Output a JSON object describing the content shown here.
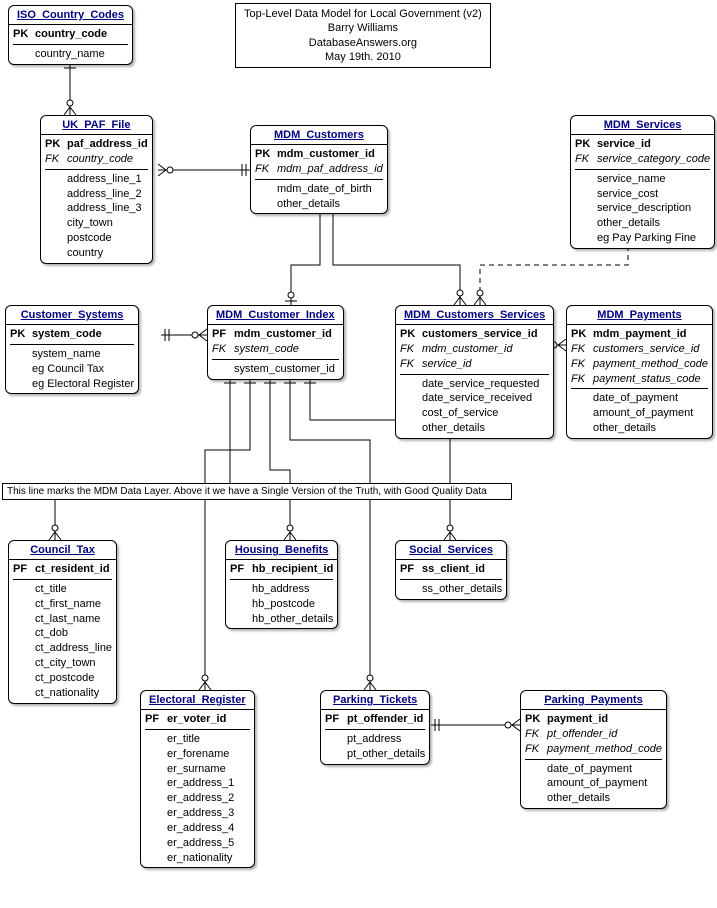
{
  "title": {
    "l1": "Top-Level Data Model for Local Government (v2)",
    "l2": "Barry Williams",
    "l3": "DatabaseAnswers.org",
    "l4": "May 19th. 2010"
  },
  "note": "This line marks the MDM Data Layer. Above it we have a Single Version of the Truth, with Good Quality Data",
  "e": {
    "iso": {
      "t": "ISO_Country_Codes",
      "a": [
        {
          "k": "PK",
          "n": "country_code",
          "pk": 1
        },
        {
          "k": "",
          "n": "country_name"
        }
      ]
    },
    "paf": {
      "t": "UK_PAF_File",
      "a": [
        {
          "k": "PK",
          "n": "paf_address_id",
          "pk": 1
        },
        {
          "k": "FK",
          "n": "country_code",
          "fk": 1
        },
        {
          "k": "",
          "n": "address_line_1"
        },
        {
          "k": "",
          "n": "address_line_2"
        },
        {
          "k": "",
          "n": "address_line_3"
        },
        {
          "k": "",
          "n": "city_town"
        },
        {
          "k": "",
          "n": "postcode"
        },
        {
          "k": "",
          "n": "country"
        }
      ]
    },
    "cust": {
      "t": "MDM_Customers",
      "a": [
        {
          "k": "PK",
          "n": "mdm_customer_id",
          "pk": 1
        },
        {
          "k": "FK",
          "n": "mdm_paf_address_id",
          "fk": 1
        },
        {
          "k": "",
          "n": "mdm_date_of_birth"
        },
        {
          "k": "",
          "n": "other_details"
        }
      ]
    },
    "svc": {
      "t": "MDM_Services",
      "a": [
        {
          "k": "PK",
          "n": "service_id",
          "pk": 1
        },
        {
          "k": "FK",
          "n": "service_category_code",
          "fk": 1
        },
        {
          "k": "",
          "n": "service_name"
        },
        {
          "k": "",
          "n": "service_cost"
        },
        {
          "k": "",
          "n": "service_description"
        },
        {
          "k": "",
          "n": "other_details"
        },
        {
          "k": "",
          "n": "eg Pay Parking Fine"
        }
      ]
    },
    "sys": {
      "t": "Customer_Systems",
      "a": [
        {
          "k": "PK",
          "n": "system_code",
          "pk": 1
        },
        {
          "k": "",
          "n": "system_name"
        },
        {
          "k": "",
          "n": "eg Council Tax"
        },
        {
          "k": "",
          "n": "eg Electoral Register"
        }
      ]
    },
    "idx": {
      "t": "MDM_Customer_Index",
      "a": [
        {
          "k": "PF",
          "n": "mdm_customer_id",
          "pk": 1
        },
        {
          "k": "FK",
          "n": "system_code",
          "fk": 1
        },
        {
          "k": "",
          "n": "system_customer_id"
        }
      ]
    },
    "cs": {
      "t": "MDM_Customers_Services",
      "a": [
        {
          "k": "PK",
          "n": "customers_service_id",
          "pk": 1
        },
        {
          "k": "FK",
          "n": "mdm_customer_id",
          "fk": 1
        },
        {
          "k": "FK",
          "n": "service_id",
          "fk": 1
        },
        {
          "k": "",
          "n": "date_service_requested"
        },
        {
          "k": "",
          "n": "date_service_received"
        },
        {
          "k": "",
          "n": "cost_of_service"
        },
        {
          "k": "",
          "n": "other_details"
        }
      ]
    },
    "pay": {
      "t": "MDM_Payments",
      "a": [
        {
          "k": "PK",
          "n": "mdm_payment_id",
          "pk": 1
        },
        {
          "k": "FK",
          "n": "customers_service_id",
          "fk": 1
        },
        {
          "k": "FK",
          "n": "payment_method_code",
          "fk": 1
        },
        {
          "k": "FK",
          "n": "payment_status_code",
          "fk": 1
        },
        {
          "k": "",
          "n": "date_of_payment"
        },
        {
          "k": "",
          "n": "amount_of_payment"
        },
        {
          "k": "",
          "n": "other_details"
        }
      ]
    },
    "ct": {
      "t": "Council_Tax",
      "a": [
        {
          "k": "PF",
          "n": "ct_resident_id",
          "pk": 1
        },
        {
          "k": "",
          "n": "ct_title"
        },
        {
          "k": "",
          "n": "ct_first_name"
        },
        {
          "k": "",
          "n": "ct_last_name"
        },
        {
          "k": "",
          "n": "ct_dob"
        },
        {
          "k": "",
          "n": "ct_address_line"
        },
        {
          "k": "",
          "n": "ct_city_town"
        },
        {
          "k": "",
          "n": "ct_postcode"
        },
        {
          "k": "",
          "n": "ct_nationality"
        }
      ]
    },
    "hb": {
      "t": "Housing_Benefits",
      "a": [
        {
          "k": "PF",
          "n": "hb_recipient_id",
          "pk": 1
        },
        {
          "k": "",
          "n": "hb_address"
        },
        {
          "k": "",
          "n": "hb_postcode"
        },
        {
          "k": "",
          "n": "hb_other_details"
        }
      ]
    },
    "ss": {
      "t": "Social_Services",
      "a": [
        {
          "k": "PF",
          "n": "ss_client_id",
          "pk": 1
        },
        {
          "k": "",
          "n": "ss_other_details"
        }
      ]
    },
    "er": {
      "t": "Electoral_Register",
      "a": [
        {
          "k": "PF",
          "n": "er_voter_id",
          "pk": 1
        },
        {
          "k": "",
          "n": "er_title"
        },
        {
          "k": "",
          "n": "er_forename"
        },
        {
          "k": "",
          "n": "er_surname"
        },
        {
          "k": "",
          "n": "er_address_1"
        },
        {
          "k": "",
          "n": "er_address_2"
        },
        {
          "k": "",
          "n": "er_address_3"
        },
        {
          "k": "",
          "n": "er_address_4"
        },
        {
          "k": "",
          "n": "er_address_5"
        },
        {
          "k": "",
          "n": "er_nationality"
        }
      ]
    },
    "pt": {
      "t": "Parking_Tickets",
      "a": [
        {
          "k": "PF",
          "n": "pt_offender_id",
          "pk": 1
        },
        {
          "k": "",
          "n": "pt_address"
        },
        {
          "k": "",
          "n": "pt_other_details"
        }
      ]
    },
    "pp": {
      "t": "Parking_Payments",
      "a": [
        {
          "k": "PK",
          "n": "payment_id",
          "pk": 1
        },
        {
          "k": "FK",
          "n": "pt_offender_id",
          "fk": 1
        },
        {
          "k": "FK",
          "n": "payment_method_code",
          "fk": 1
        },
        {
          "k": "",
          "n": "date_of_payment"
        },
        {
          "k": "",
          "n": "amount_of_payment"
        },
        {
          "k": "",
          "n": "other_details"
        }
      ]
    }
  }
}
